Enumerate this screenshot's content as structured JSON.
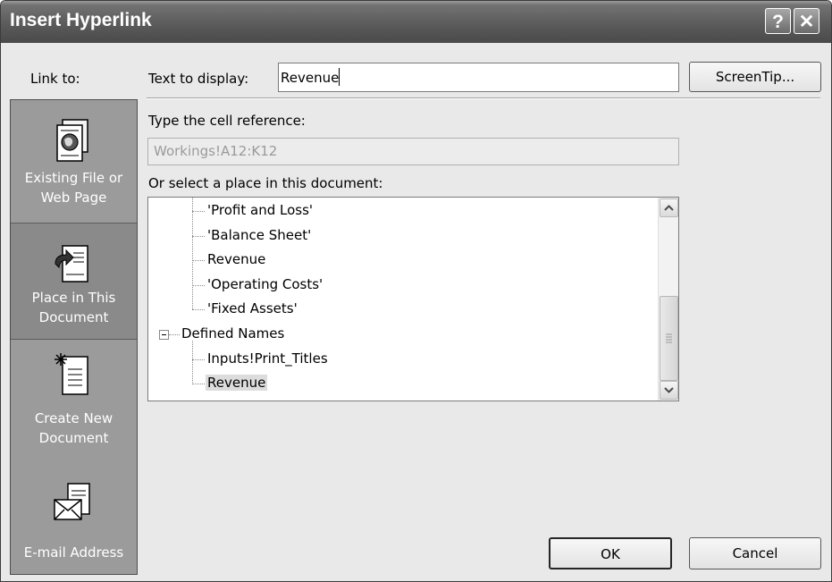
{
  "window": {
    "title": "Insert Hyperlink",
    "help_label": "?",
    "close_label": "✕"
  },
  "link_to": {
    "label": "Link to:",
    "items": [
      {
        "label_line1": "Existing File or",
        "label_line2": "Web Page",
        "icon": "web-page-icon",
        "selected": false
      },
      {
        "label_line1": "Place in This",
        "label_line2": "Document",
        "icon": "place-in-document-icon",
        "selected": true
      },
      {
        "label_line1": "Create New",
        "label_line2": "Document",
        "icon": "new-document-icon",
        "selected": false
      },
      {
        "label_line1": "E-mail Address",
        "label_line2": "",
        "icon": "email-envelope-icon",
        "selected": false
      }
    ]
  },
  "text_to_display": {
    "label": "Text to display:",
    "value": "Revenue"
  },
  "screentip_button": "ScreenTip...",
  "cell_reference": {
    "label": "Type the cell reference:",
    "value": "Workings!A12:K12"
  },
  "place_list": {
    "label": "Or select a place in this document:",
    "items": [
      {
        "text": "'Profit and Loss'",
        "selected": false
      },
      {
        "text": "'Balance Sheet'",
        "selected": false
      },
      {
        "text": "Revenue",
        "selected": false
      },
      {
        "text": "'Operating Costs'",
        "selected": false
      },
      {
        "text": "'Fixed Assets'",
        "selected": false
      },
      {
        "text": "Defined Names",
        "selected": false
      },
      {
        "text": "Inputs!Print_Titles",
        "selected": false
      },
      {
        "text": "Revenue",
        "selected": true
      }
    ]
  },
  "buttons": {
    "ok": "OK",
    "cancel": "Cancel"
  },
  "colors": {
    "title_bar": "#595959",
    "link_bar": "#9b9b9b",
    "dialog_bg": "#e9e9e9"
  }
}
